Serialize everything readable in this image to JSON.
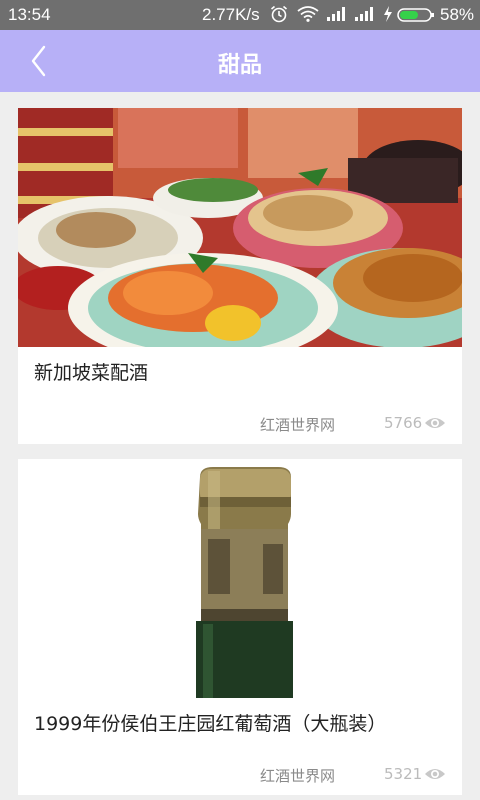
{
  "status_bar": {
    "time": "13:54",
    "net_speed": "2.77K/s",
    "battery_percent": "58%",
    "icons": [
      "alarm-icon",
      "wifi-icon",
      "signal-icon",
      "signal-icon",
      "charging-icon",
      "battery-icon"
    ]
  },
  "header": {
    "title": "甜品",
    "back_icon": "chevron-left-icon",
    "background_color": "#b7b0f7"
  },
  "articles": [
    {
      "title": "新加坡菜配酒",
      "source": "红酒世界网",
      "views": "5766",
      "image": "food-photo"
    },
    {
      "title": "1999年份侯伯王庄园红葡萄酒（大瓶装）",
      "source": "红酒世界网",
      "views": "5321",
      "image": "wine-bottle-photo"
    }
  ]
}
